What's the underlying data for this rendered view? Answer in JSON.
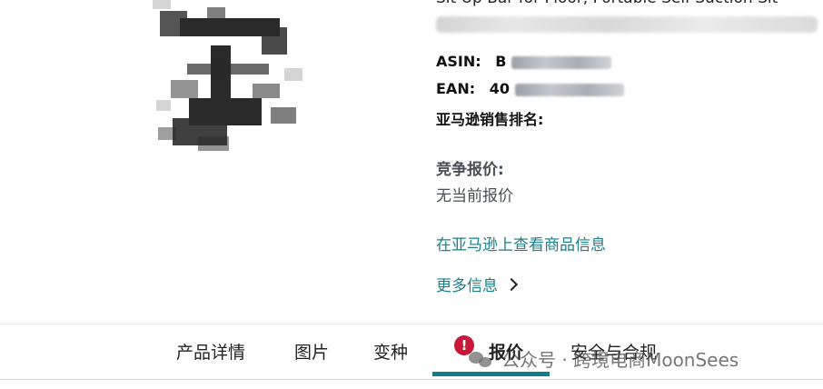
{
  "product": {
    "title_visible": "Sit Up Bar for Floor, Portable Self-Suction Sit",
    "image_icon": "product-photo-pixelated"
  },
  "attributes": {
    "asin_label": "ASIN:",
    "asin_value_prefix": "B",
    "ean_label": "EAN:",
    "ean_value_prefix": "40",
    "rank_label": "亚马逊销售排名:"
  },
  "offers": {
    "label": "竞争报价:",
    "value": "无当前报价"
  },
  "links": {
    "view_on_amazon": "在亚马逊上查看商品信息",
    "more_info": "更多信息"
  },
  "tabs": [
    {
      "label": "产品详情"
    },
    {
      "label": "图片"
    },
    {
      "label": "变种"
    },
    {
      "label": "报价",
      "active": true,
      "alert": "!"
    },
    {
      "label": "安全与合规"
    }
  ],
  "watermark": {
    "text": "公众号 · 跨境电商MoonSees"
  },
  "colors": {
    "link": "#1a7f8a",
    "alert": "#c7183a",
    "tab_underline": "#127c8a"
  }
}
